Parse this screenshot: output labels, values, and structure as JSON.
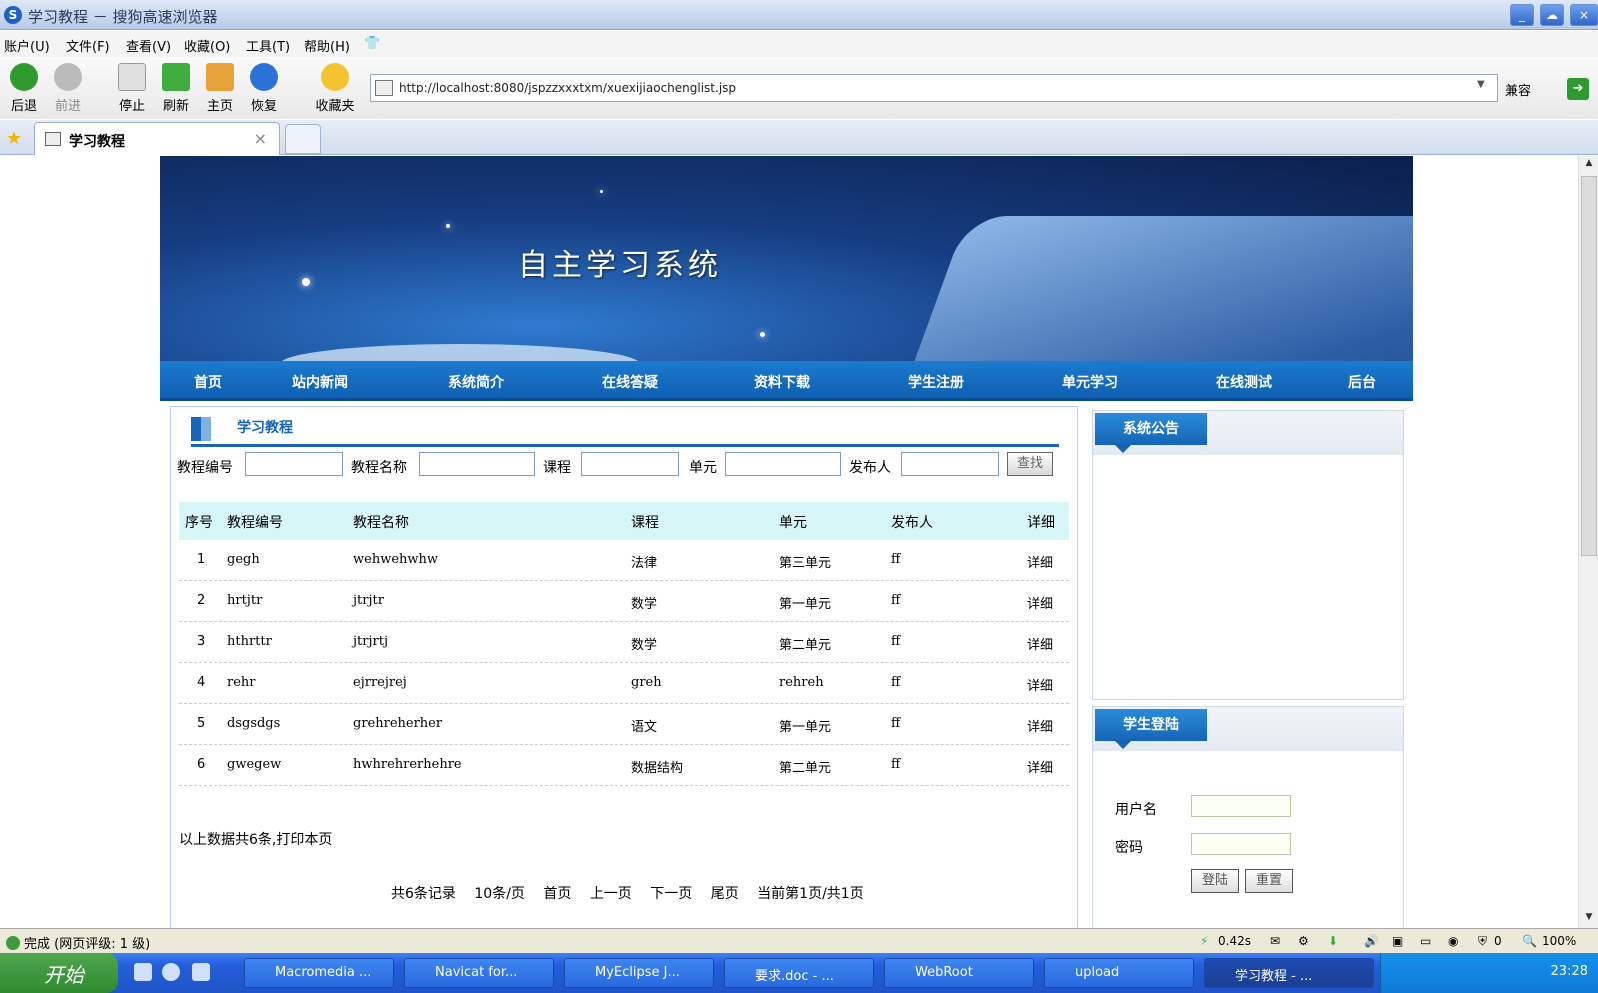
{
  "window": {
    "title": "学习教程 － 搜狗高速浏览器"
  },
  "menu": [
    "账户(U)",
    "文件(F)",
    "查看(V)",
    "收藏(O)",
    "工具(T)",
    "帮助(H)"
  ],
  "toolbar": {
    "back": "后退",
    "forward": "前进",
    "stop": "停止",
    "refresh": "刷新",
    "home": "主页",
    "restore": "恢复",
    "favorites": "收藏夹",
    "compat": "兼容"
  },
  "address": {
    "url": "http://localhost:8080/jspzzxxxtxm/xuexijiaochenglist.jsp"
  },
  "tab": {
    "title": "学习教程",
    "close": "×"
  },
  "banner": {
    "title": "自主学习系统"
  },
  "nav": [
    "首页",
    "站内新闻",
    "系统简介",
    "在线答疑",
    "资料下载",
    "学生注册",
    "单元学习",
    "在线测试",
    "后台"
  ],
  "section": {
    "title": "学习教程"
  },
  "search": {
    "labels": [
      "教程编号",
      "教程名称",
      "课程",
      "单元",
      "发布人"
    ],
    "button": "查找"
  },
  "table": {
    "headers": [
      "序号",
      "教程编号",
      "教程名称",
      "课程",
      "单元",
      "发布人",
      "详细"
    ],
    "rows": [
      [
        "1",
        "gegh",
        "wehwehwhw",
        "法律",
        "第三单元",
        "ff",
        "详细"
      ],
      [
        "2",
        "hrtjtr",
        "jtrjtr",
        "数学",
        "第一单元",
        "ff",
        "详细"
      ],
      [
        "3",
        "hthrttr",
        "jtrjrtj",
        "数学",
        "第二单元",
        "ff",
        "详细"
      ],
      [
        "4",
        "rehr",
        "ejrrejrej",
        "greh",
        "rehreh",
        "ff",
        "详细"
      ],
      [
        "5",
        "dsgsdgs",
        "grehreherher",
        "语文",
        "第一单元",
        "ff",
        "详细"
      ],
      [
        "6",
        "gwegew",
        "hwhrehrerhehre",
        "数据结构",
        "第二单元",
        "ff",
        "详细"
      ]
    ]
  },
  "total": "以上数据共6条,打印本页",
  "pager": [
    "共6条记录",
    "10条/页",
    "首页",
    "上一页",
    "下一页",
    "尾页",
    "当前第1页/共1页"
  ],
  "notice": {
    "title": "系统公告"
  },
  "login": {
    "title": "学生登陆",
    "username": "用户名",
    "password": "密码",
    "submit": "登陆",
    "reset": "重置"
  },
  "status": {
    "text": "完成 (网页评级: 1 级)",
    "time": "0.42s",
    "count": "0",
    "zoom": "100%"
  },
  "taskbar": {
    "start": "开始",
    "tasks": [
      "Macromedia ...",
      "Navicat for...",
      "MyEclipse J...",
      "要求.doc - ...",
      "WebRoot",
      "upload",
      "学习教程 - ..."
    ],
    "clock": "23:28"
  }
}
